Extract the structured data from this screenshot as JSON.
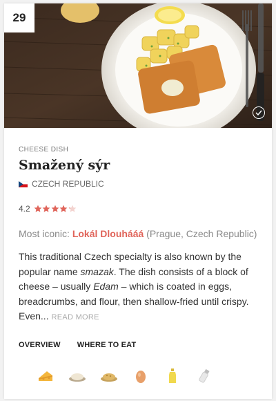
{
  "card": {
    "rank": "29",
    "category": "CHEESE DISH",
    "dish_name": "Smažený sýr",
    "country": "CZECH REPUBLIC",
    "rating": "4.2",
    "stars_value": 4.2,
    "stars_max": 5,
    "iconic_prefix": "Most iconic: ",
    "iconic_place": "Lokál Dlouhááá",
    "iconic_location": " (Prague, Czech Republic)",
    "description": {
      "part1": "This traditional Czech specialty is also known by the popular name ",
      "em1": "smazak",
      "part2": ". The dish consists of a block of cheese – usually ",
      "em2": "Edam",
      "part3": " – which is coated in eggs, breadcrumbs, and flour, then shallow-fried until crispy. Even... "
    },
    "read_more": "READ MORE",
    "tabs": [
      "OVERVIEW",
      "WHERE TO EAT"
    ],
    "ingredient_icons": [
      "cheese-icon",
      "flour-icon",
      "breadcrumbs-icon",
      "egg-icon",
      "oil-icon",
      "salt-icon"
    ]
  },
  "colors": {
    "accent": "#e0645a",
    "star": "#e0645a",
    "flag_white": "#ffffff",
    "flag_red": "#d7141a",
    "flag_blue": "#11457e"
  }
}
